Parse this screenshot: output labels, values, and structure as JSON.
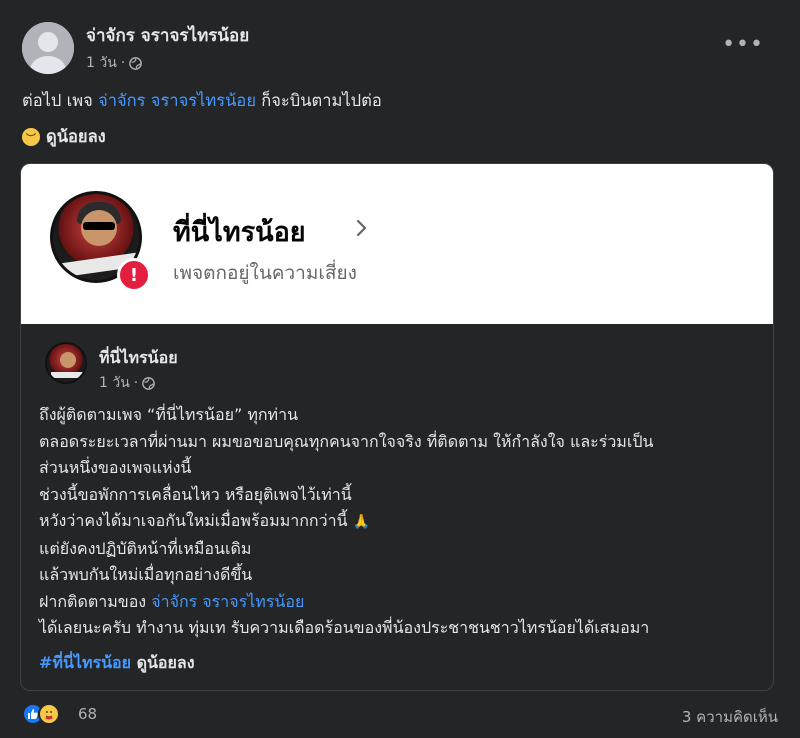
{
  "post": {
    "author": "จ่าจักร จราจรไทรน้อย",
    "time": "1 วัน",
    "line1_prefix": "ต่อไป เพจ",
    "line1_link": "จ่าจักร จราจรไทรน้อย",
    "line1_suffix": "ก็จะบินตามไปต่อ",
    "see_less": "ดูน้อยลง",
    "more_icon": "more-horizontal-icon"
  },
  "shared_page": {
    "name": "ที่นี่ไทรน้อย",
    "status": "เพจตกอยู่ในความเสี่ยง",
    "warning_icon": "!",
    "inner_name": "ที่นี่ไทรน้อย",
    "inner_time": "1 วัน",
    "body_lines": [
      "ถึงผู้ติดตามเพจ “ที่นี่ไทรน้อย” ทุกท่าน",
      "ตลอดระยะเวลาที่ผ่านมา ผมขอขอบคุณทุกคนจากใจจริง ที่ติดตาม ให้กำลังใจ และร่วมเป็น",
      "ส่วนหนึ่งของเพจแห่งนี้",
      "ช่วงนี้ขอพักการเคลื่อนไหว หรือยุติเพจไว้เท่านี้",
      "หวังว่าคงได้มาเจอกันใหม่เมื่อพร้อมมากกว่านี้",
      "แต่ยังคงปฏิบัติหน้าที่เหมือนเดิม",
      "แล้วพบกันใหม่เมื่อทุกอย่างดีขึ้น"
    ],
    "follow_prefix": "ฝากติดตามของ",
    "follow_link": "จ่าจักร จราจรไทรน้อย",
    "last_line": "ได้เลยนะครับ ทำงาน ทุ่มเท รับความเดือดร้อนของพี่น้องประชาชนชาวไทรน้อยได้เสมอมา",
    "hashtag": "#ที่นี่ไทรน้อย",
    "see_less": "ดูน้อยลง"
  },
  "footer": {
    "reaction_count": "68",
    "comments": "3 ความคิดเห็น"
  },
  "colors": {
    "background": "#242526",
    "link": "#4599ff",
    "warning": "#e41e3f"
  }
}
